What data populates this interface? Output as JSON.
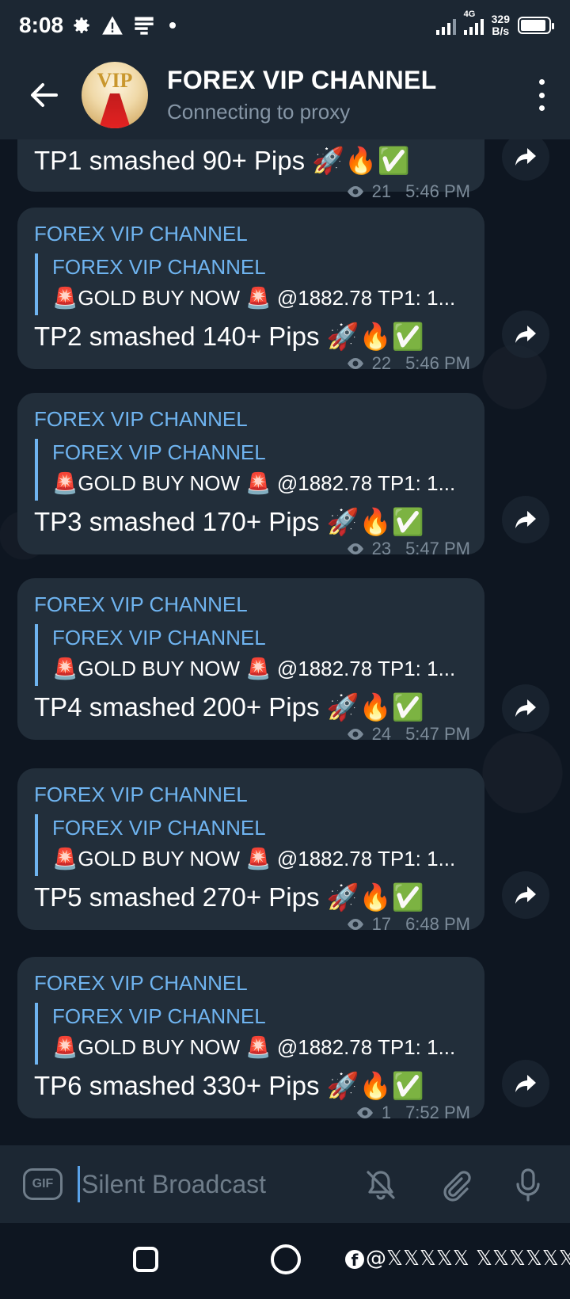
{
  "status_bar": {
    "time": "8:08",
    "network_type": "4G",
    "speed_value": "329",
    "speed_unit": "B/s"
  },
  "header": {
    "title": "FOREX VIP CHANNEL",
    "status": "Connecting to proxy",
    "avatar_text": "VIP"
  },
  "messages": [
    {
      "sender": "",
      "quote_title": "",
      "quote_text": "",
      "text": "TP1  smashed 90+ Pips 🚀🔥✅",
      "views": "21",
      "time": "5:46 PM"
    },
    {
      "sender": "FOREX VIP CHANNEL",
      "quote_title": "FOREX VIP CHANNEL",
      "quote_text": "🚨GOLD BUY NOW 🚨  @1882.78  TP1: 1...",
      "text": "TP2  smashed 140+ Pips 🚀🔥✅",
      "views": "22",
      "time": "5:46 PM"
    },
    {
      "sender": "FOREX VIP CHANNEL",
      "quote_title": "FOREX VIP CHANNEL",
      "quote_text": "🚨GOLD BUY NOW 🚨  @1882.78  TP1: 1...",
      "text": "TP3  smashed 170+ Pips 🚀🔥✅",
      "views": "23",
      "time": "5:47 PM"
    },
    {
      "sender": "FOREX VIP CHANNEL",
      "quote_title": "FOREX VIP CHANNEL",
      "quote_text": "🚨GOLD BUY NOW 🚨  @1882.78  TP1: 1...",
      "text": "TP4  smashed 200+ Pips 🚀🔥✅",
      "views": "24",
      "time": "5:47 PM"
    },
    {
      "sender": "FOREX VIP CHANNEL",
      "quote_title": "FOREX VIP CHANNEL",
      "quote_text": "🚨GOLD BUY NOW 🚨  @1882.78  TP1: 1...",
      "text": "TP5  smashed 270+ Pips 🚀🔥✅",
      "views": "17",
      "time": "6:48 PM"
    },
    {
      "sender": "FOREX VIP CHANNEL",
      "quote_title": "FOREX VIP CHANNEL",
      "quote_text": "🚨GOLD BUY NOW 🚨  @1882.78  TP1: 1...",
      "text": "TP6  smashed 330+ Pips 🚀🔥✅",
      "views": "1",
      "time": "7:52 PM"
    }
  ],
  "input": {
    "gif_label": "GIF",
    "placeholder": "Silent Broadcast"
  },
  "nav": {
    "watermark": "@𝕏𝕏𝕏𝕏𝕏 𝕏𝕏𝕏𝕏𝕏𝕏"
  },
  "colors": {
    "background": "#0e1621",
    "bar": "#1c2733",
    "bubble": "#222e3a",
    "accent": "#6fb4f0",
    "muted": "#7c8b99"
  }
}
